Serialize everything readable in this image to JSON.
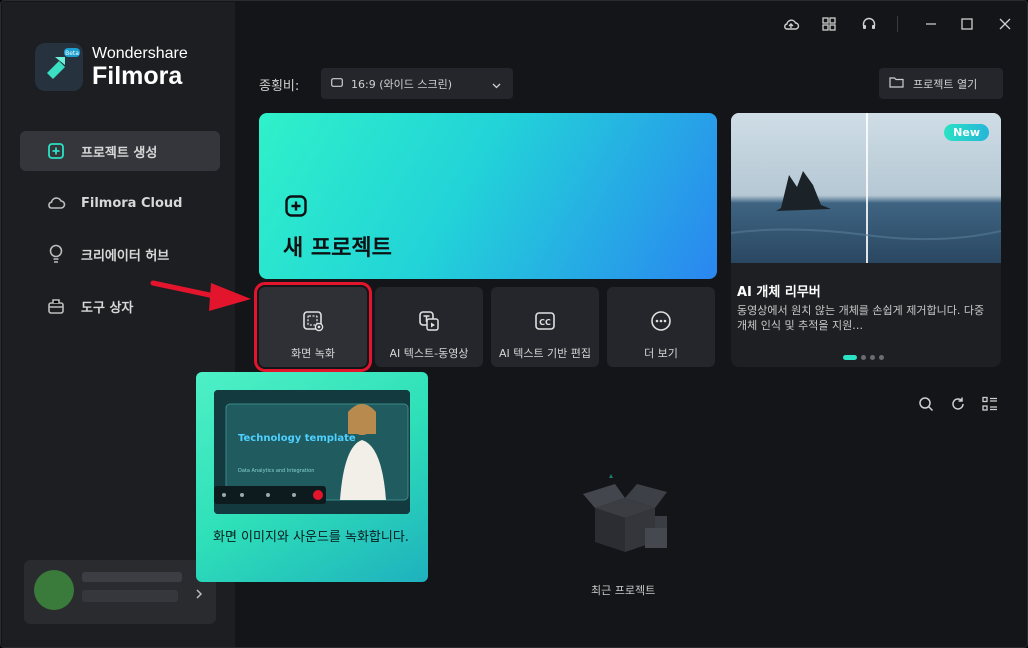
{
  "app": {
    "brand_top": "Wondershare",
    "brand_name": "Filmora",
    "beta_badge": "Beta"
  },
  "sidebar": {
    "items": [
      {
        "label": "프로젝트 생성",
        "icon": "plus-square-icon",
        "active": true
      },
      {
        "label": "Filmora Cloud",
        "icon": "cloud-icon",
        "active": false
      },
      {
        "label": "크리에이터 허브",
        "icon": "lightbulb-icon",
        "active": false
      },
      {
        "label": "도구 상자",
        "icon": "toolbox-icon",
        "active": false
      }
    ]
  },
  "titlebar": {
    "icons": [
      "cloud-upload-icon",
      "grid-icon",
      "headset-icon",
      "minimize-icon",
      "maximize-icon",
      "close-icon"
    ]
  },
  "toolbar": {
    "ratio_label": "종횡비:",
    "ratio_value": "16:9 (와이드 스크린)",
    "open_project_label": "프로젝트 열기"
  },
  "new_project": {
    "title": "새 프로젝트"
  },
  "quick_tools": [
    {
      "label": "화면 녹화",
      "icon": "screen-record-icon",
      "selected": true
    },
    {
      "label": "AI 텍스트-동영상",
      "icon": "text-to-video-icon",
      "selected": false
    },
    {
      "label": "AI 텍스트 기반 편집",
      "icon": "cc-icon",
      "selected": false
    },
    {
      "label": "더 보기",
      "icon": "more-icon",
      "selected": false
    }
  ],
  "banner": {
    "badge": "New",
    "title": "AI 개체 리무버",
    "description": "동영상에서 원치 않는 개체를 손쉽게 제거합니다. 다중 개체 인식 및 추적을 지원…",
    "dots": 4,
    "active_dot": 0
  },
  "tooltip": {
    "preview_title": "Technology template",
    "preview_sub": "Data Analytics and Integration",
    "description": "화면 이미지와 사운드를 녹화합니다."
  },
  "recent": {
    "label": "최근 프로젝트"
  },
  "colors": {
    "accent": "#2ae2c4",
    "highlight_box": "#e3152d",
    "sidebar_bg": "#1d1e22",
    "main_bg": "#141518"
  }
}
